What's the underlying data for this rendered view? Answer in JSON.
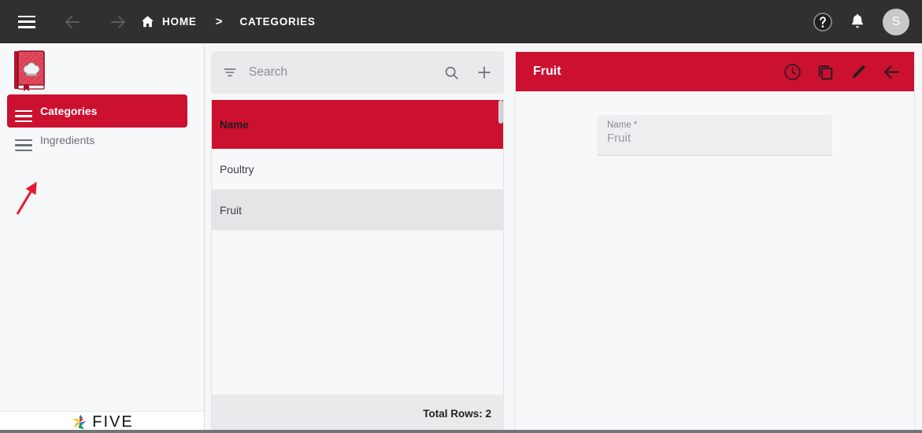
{
  "topbar": {
    "menu_icon": "hamburger-menu-icon",
    "back_icon": "arrow-left-icon",
    "forward_icon": "arrow-right-icon",
    "home_icon": "home-icon",
    "home_label": "HOME",
    "separator": ">",
    "current_label": "CATEGORIES",
    "help_icon": "help-circle-icon",
    "notifications_icon": "bell-icon",
    "avatar_initial": "S"
  },
  "sidebar": {
    "logo_icon": "recipe-book-icon",
    "items": [
      {
        "label": "Categories",
        "icon": "hamburger-menu-icon",
        "active": true
      },
      {
        "label": "Ingredients",
        "icon": "hamburger-menu-icon",
        "active": false
      }
    ],
    "footer_brand": "FIVE",
    "footer_icon": "five-pinwheel-logo"
  },
  "annotation": {
    "type": "red-arrow",
    "color": "#e8192c",
    "points_to": "Ingredients menu icon"
  },
  "list_panel": {
    "search": {
      "filter_icon": "filter-icon",
      "placeholder": "Search",
      "value": "",
      "search_icon": "search-icon",
      "add_icon": "plus-icon"
    },
    "table": {
      "columns": [
        "Name"
      ],
      "rows": [
        {
          "name": "Poultry",
          "selected": false
        },
        {
          "name": "Fruit",
          "selected": true
        }
      ],
      "footer_text": "Total Rows: 2"
    }
  },
  "detail_panel": {
    "title": "Fruit",
    "actions": [
      {
        "name": "history-clock-icon"
      },
      {
        "name": "copy-icon"
      },
      {
        "name": "edit-pencil-icon"
      },
      {
        "name": "back-arrow-icon"
      }
    ],
    "fields": [
      {
        "label": "Name *",
        "value": "Fruit"
      }
    ]
  },
  "colors": {
    "brand_red": "#cc1030",
    "topbar_dark": "#303030",
    "panel_bg": "#f7f8fa",
    "search_bg": "#e9eaec",
    "selected_row": "#e4e5e7"
  }
}
